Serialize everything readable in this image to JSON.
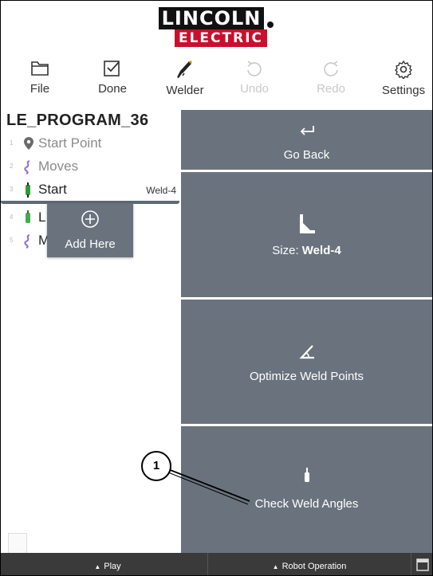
{
  "logo": {
    "top": "LINCOLN",
    "bottom": "ELECTRIC"
  },
  "toolbar": [
    {
      "label": "File",
      "icon": "folder-icon",
      "enabled": true
    },
    {
      "label": "Done",
      "icon": "checkbox-icon",
      "enabled": true
    },
    {
      "label": "Welder",
      "icon": "welder-torch-icon",
      "enabled": true
    },
    {
      "label": "Undo",
      "icon": "undo-icon",
      "enabled": false
    },
    {
      "label": "Redo",
      "icon": "redo-icon",
      "enabled": false
    },
    {
      "label": "Settings",
      "icon": "gear-icon",
      "enabled": true
    }
  ],
  "program": {
    "name": "LE_PROGRAM_36",
    "steps": [
      {
        "num": "1",
        "label": "Start Point",
        "icon": "location-pin-icon",
        "tag": ""
      },
      {
        "num": "2",
        "label": "Moves",
        "icon": "moves-squiggle-icon",
        "tag": ""
      },
      {
        "num": "3",
        "label": "Start",
        "icon": "weld-start-icon",
        "tag": "Weld-4"
      },
      {
        "num": "4",
        "label": "L",
        "icon": "weld-icon",
        "tag": ""
      },
      {
        "num": "5",
        "label": "M",
        "icon": "moves-squiggle-icon",
        "tag": ""
      }
    ]
  },
  "popup": {
    "label": "Add Here",
    "icon": "plus-circle-icon"
  },
  "actions": {
    "go_back": "Go Back",
    "size_prefix": "Size: ",
    "size_value": "Weld-4",
    "optimize": "Optimize Weld Points",
    "check_angles": "Check Weld Angles"
  },
  "callout": {
    "number": "1"
  },
  "bottom_bar": {
    "play": "Play",
    "robot_operation": "Robot Operation"
  },
  "colors": {
    "panel": "#6a737d",
    "brand_red": "#c8102e",
    "bottom_bar": "#3a3a3a",
    "accent_purple": "#8b6fd6",
    "weld_green": "#2e9b3a"
  }
}
